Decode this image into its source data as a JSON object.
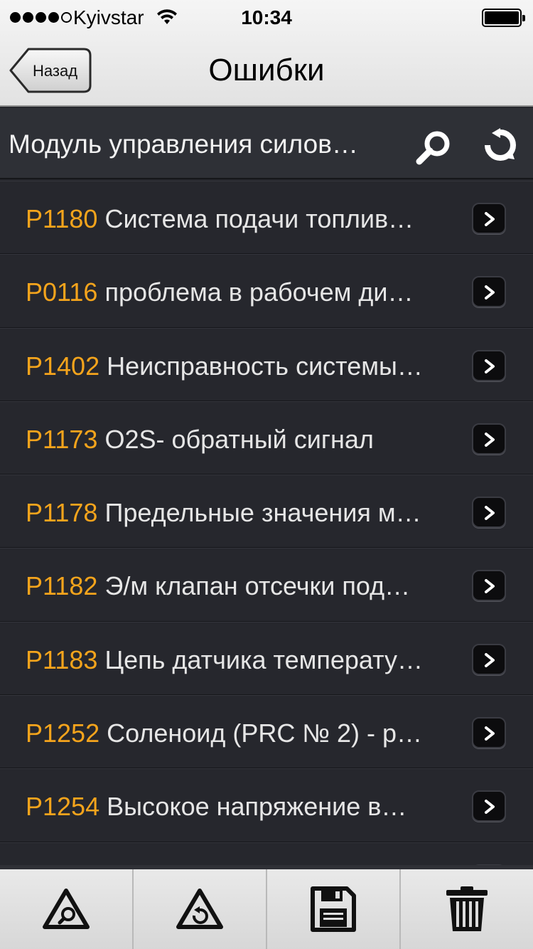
{
  "status_bar": {
    "carrier": "Kyivstar",
    "time": "10:34",
    "signal_bars": 4,
    "signal_max": 5
  },
  "nav": {
    "back_label": "Назад",
    "title": "Ошибки"
  },
  "module": {
    "title": "Модуль управления силов…"
  },
  "errors": [
    {
      "code": "P1180",
      "text": "Система подачи топлив…"
    },
    {
      "code": "P0116",
      "text": "проблема в рабочем ди…"
    },
    {
      "code": "P1402",
      "text": "Неисправность системы…"
    },
    {
      "code": "P1173",
      "text": "O2S- обратный сигнал"
    },
    {
      "code": "P1178",
      "text": "Предельные значения м…"
    },
    {
      "code": "P1182",
      "text": "Э/м клапан отсечки под…"
    },
    {
      "code": "P1183",
      "text": "Цепь датчика температу…"
    },
    {
      "code": "P1252",
      "text": "Соленоид (PRC № 2) - р…"
    },
    {
      "code": "P1254",
      "text": "Высокое напряжение в…"
    }
  ],
  "toolbar": [
    {
      "icon": "triangle-search-icon"
    },
    {
      "icon": "triangle-refresh-icon"
    },
    {
      "icon": "floppy-disk-icon"
    },
    {
      "icon": "trash-icon"
    }
  ],
  "colors": {
    "code": "#f4a41c",
    "list_bg": "#26272d",
    "text": "#e6e6e6"
  }
}
